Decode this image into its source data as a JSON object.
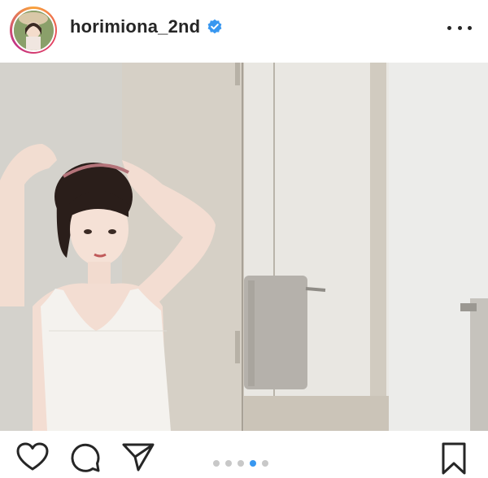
{
  "header": {
    "username": "horimiona_2nd",
    "verified": true,
    "avatar_icon": "profile-photo",
    "more_icon": "more-horizontal-icon"
  },
  "post": {
    "image_description_icon": "post-photo",
    "carousel": {
      "count": 5,
      "active_index": 3
    }
  },
  "actions": {
    "like_icon": "heart-icon",
    "comment_icon": "comment-icon",
    "share_icon": "send-icon",
    "save_icon": "bookmark-icon"
  },
  "colors": {
    "verified_blue": "#3897f0",
    "active_dot": "#3897f0",
    "inactive_dot": "#c8c8c8",
    "text": "#262626"
  }
}
